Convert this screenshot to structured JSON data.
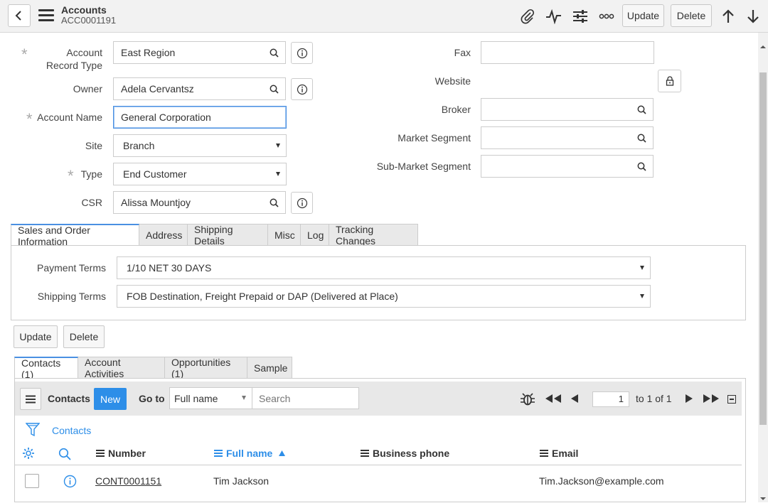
{
  "header": {
    "title": "Accounts",
    "record_id": "ACC0001191",
    "update_label": "Update",
    "delete_label": "Delete"
  },
  "form_left": {
    "account_record_type": {
      "label": "Account Record Type",
      "value": "East Region"
    },
    "owner": {
      "label": "Owner",
      "value": "Adela Cervantsz"
    },
    "account_name": {
      "label": "Account Name",
      "value": "General Corporation"
    },
    "site": {
      "label": "Site",
      "value": "Branch"
    },
    "type": {
      "label": "Type",
      "value": "End Customer"
    },
    "csr": {
      "label": "CSR",
      "value": "Alissa Mountjoy"
    }
  },
  "form_right": {
    "fax": {
      "label": "Fax",
      "value": ""
    },
    "website": {
      "label": "Website"
    },
    "broker": {
      "label": "Broker",
      "value": ""
    },
    "market_segment": {
      "label": "Market Segment",
      "value": ""
    },
    "sub_market_segment": {
      "label": "Sub-Market Segment",
      "value": ""
    }
  },
  "tabs": [
    "Sales and Order Information",
    "Address",
    "Shipping Details",
    "Misc",
    "Log",
    "Tracking Changes"
  ],
  "sales": {
    "payment_terms": {
      "label": "Payment Terms",
      "value": "1/10 NET 30 DAYS"
    },
    "shipping_terms": {
      "label": "Shipping Terms",
      "value": "FOB Destination, Freight Prepaid or DAP (Delivered at Place)"
    }
  },
  "actions": {
    "update": "Update",
    "delete": "Delete"
  },
  "detail_tabs": [
    "Contacts (1)",
    "Account Activities",
    "Opportunities (1)",
    "Sample"
  ],
  "grid": {
    "title": "Contacts",
    "new_label": "New",
    "goto_label": "Go to",
    "goto_select": "Full name",
    "search_placeholder": "Search",
    "page": "1",
    "page_of": "to 1 of 1",
    "filter_label": "Contacts",
    "columns": [
      "Number",
      "Full name",
      "Business phone",
      "Email"
    ],
    "rows": [
      {
        "number": "CONT0001151",
        "full_name": "Tim Jackson",
        "business_phone": "",
        "email": "Tim.Jackson@example.com"
      }
    ]
  },
  "colors": {
    "accent": "#2d8ee8",
    "tab_active": "#4a90e2"
  }
}
